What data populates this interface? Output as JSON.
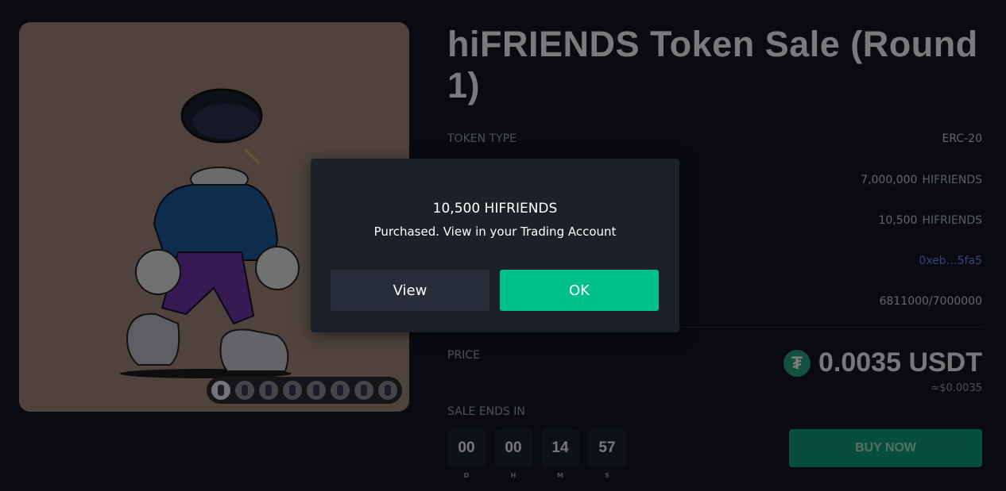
{
  "sale": {
    "title": "hiFRIENDS Token Sale (Round 1)",
    "rows": [
      {
        "label": "TOKEN TYPE",
        "value": "ERC-20",
        "unit": ""
      },
      {
        "label": "",
        "value": "7,000,000",
        "unit": "HIFRIENDS"
      },
      {
        "label": "",
        "value": "10,500",
        "unit": "HIFRIENDS"
      },
      {
        "label": "",
        "value": "0xeb…5fa5",
        "unit": ""
      },
      {
        "label": "",
        "value": "6811000/7000000",
        "unit": ""
      }
    ],
    "price_label": "PRICE",
    "price_icon": "tether-icon",
    "price_icon_glyph": "₮",
    "price_value": "0.0035 USDT",
    "price_usd": "≈$0.0035",
    "ends_label": "SALE ENDS IN",
    "countdown": [
      {
        "value": "00",
        "unit": "D"
      },
      {
        "value": "00",
        "unit": "H"
      },
      {
        "value": "14",
        "unit": "M"
      },
      {
        "value": "57",
        "unit": "S"
      }
    ],
    "buy_label": "BUY NOW"
  },
  "modal": {
    "amount": "10,500 HIFRIENDS",
    "message": "Purchased. View in your Trading Account",
    "view_label": "View",
    "ok_label": "OK"
  },
  "colors": {
    "accent": "#00c08b",
    "tether": "#26a17b",
    "link": "#6a8cff",
    "background": "#121722"
  }
}
